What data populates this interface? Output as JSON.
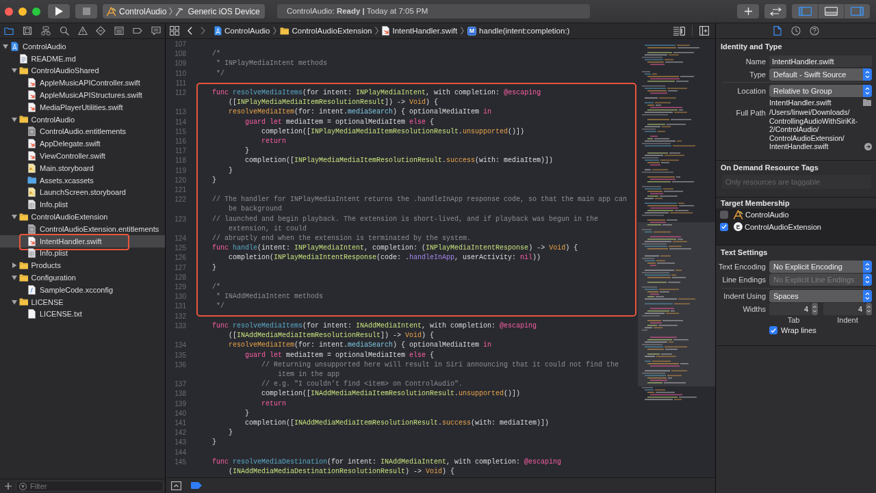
{
  "toolbar": {
    "scheme": {
      "target": "ControlAudio",
      "destination": "Generic iOS Device"
    },
    "status": "ControlAudio: **Ready |** Today at 7:05 PM",
    "panel_toggles": [
      {
        "kind": "navigator",
        "selected": true
      },
      {
        "kind": "debug_area",
        "selected": false
      },
      {
        "kind": "inspector",
        "selected": true
      }
    ]
  },
  "navigator": {
    "tabs": [
      {
        "kind": "project",
        "selected": true
      },
      {
        "kind": "source_control",
        "selected": false
      },
      {
        "kind": "symbol",
        "selected": false
      },
      {
        "kind": "find",
        "selected": false
      },
      {
        "kind": "issue",
        "selected": false
      },
      {
        "kind": "test",
        "selected": false
      },
      {
        "kind": "debug",
        "selected": false
      },
      {
        "kind": "breakpoint",
        "selected": false
      },
      {
        "kind": "report",
        "selected": false
      }
    ],
    "tree": [
      {
        "label": "ControlAudio",
        "kind": "project",
        "expanded": true,
        "selected": false,
        "annotated": false,
        "children": [
          {
            "label": "README.md",
            "kind": "markdown",
            "selected": false,
            "annotated": false
          },
          {
            "label": "ControlAudioShared",
            "kind": "folder",
            "expanded": true,
            "selected": false,
            "annotated": false,
            "children": [
              {
                "label": "AppleMusicAPIController.swift",
                "kind": "swift",
                "selected": false,
                "annotated": false
              },
              {
                "label": "AppleMusicAPIStructures.swift",
                "kind": "swift",
                "selected": false,
                "annotated": false
              },
              {
                "label": "MediaPlayerUtilities.swift",
                "kind": "swift",
                "selected": false,
                "annotated": false
              }
            ]
          },
          {
            "label": "ControlAudio",
            "kind": "folder",
            "expanded": true,
            "selected": false,
            "annotated": false,
            "children": [
              {
                "label": "ControlAudio.entitlements",
                "kind": "entitlements",
                "selected": false,
                "annotated": false
              },
              {
                "label": "AppDelegate.swift",
                "kind": "swift",
                "selected": false,
                "annotated": false
              },
              {
                "label": "ViewController.swift",
                "kind": "swift",
                "selected": false,
                "annotated": false
              },
              {
                "label": "Main.storyboard",
                "kind": "storyboard",
                "selected": false,
                "annotated": false
              },
              {
                "label": "Assets.xcassets",
                "kind": "assets",
                "selected": false,
                "annotated": false
              },
              {
                "label": "LaunchScreen.storyboard",
                "kind": "storyboard",
                "selected": false,
                "annotated": false
              },
              {
                "label": "Info.plist",
                "kind": "plist",
                "selected": false,
                "annotated": false
              }
            ]
          },
          {
            "label": "ControlAudioExtension",
            "kind": "folder",
            "expanded": true,
            "selected": false,
            "annotated": false,
            "children": [
              {
                "label": "ControlAudioExtension.entitlements",
                "kind": "entitlements",
                "selected": false,
                "annotated": false
              },
              {
                "label": "IntentHandler.swift",
                "kind": "swift",
                "selected": true,
                "annotated": true
              },
              {
                "label": "Info.plist",
                "kind": "plist",
                "selected": false,
                "annotated": false
              }
            ]
          },
          {
            "label": "Products",
            "kind": "folder",
            "expanded": false,
            "selected": false,
            "annotated": false
          },
          {
            "label": "Configuration",
            "kind": "folder",
            "expanded": true,
            "selected": false,
            "annotated": false,
            "children": [
              {
                "label": "SampleCode.xcconfig",
                "kind": "xcconfig",
                "selected": false,
                "annotated": false
              }
            ]
          },
          {
            "label": "LICENSE",
            "kind": "folder",
            "expanded": true,
            "selected": false,
            "annotated": false,
            "children": [
              {
                "label": "LICENSE.txt",
                "kind": "text",
                "selected": false,
                "annotated": false
              }
            ]
          }
        ]
      }
    ],
    "filter": {
      "placeholder": "Filter"
    }
  },
  "editor": {
    "jump_bar": [
      {
        "kind": "project",
        "label": "ControlAudio"
      },
      {
        "kind": "folder",
        "label": "ControlAudioExtension"
      },
      {
        "kind": "swift",
        "label": "IntentHandler.swift"
      },
      {
        "kind": "method",
        "badge": "M",
        "label": "handle(intent:completion:)"
      }
    ],
    "sections": [
      {
        "annotated": false,
        "lines": [
          {
            "number": "107"
          },
          {
            "number": "108",
            "tokens": [
              {
                "kind": "comment",
                "text": "    /*"
              }
            ]
          },
          {
            "number": "109",
            "tokens": [
              {
                "kind": "comment",
                "text": "     * INPlayMediaIntent methods"
              }
            ]
          },
          {
            "number": "110",
            "tokens": [
              {
                "kind": "comment",
                "text": "     */"
              }
            ]
          },
          {
            "number": "111"
          }
        ]
      },
      {
        "annotated": true,
        "lines": [
          {
            "number": "112",
            "tokens": [
              {
                "kind": "keyword",
                "text": "    func "
              },
              {
                "kind": "declaration",
                "text": "resolveMediaItems"
              },
              {
                "kind": "plain",
                "text": "(for intent: "
              },
              {
                "kind": "type",
                "text": "INPlayMediaIntent"
              },
              {
                "kind": "plain",
                "text": ", with completion: "
              },
              {
                "kind": "keyword",
                "text": "@escaping"
              },
              {
                "kind": "plain",
                "text": " (["
              },
              {
                "kind": "type",
                "text": "INPlayMediaMediaItemResolutionResult"
              },
              {
                "kind": "plain",
                "text": "]) -> "
              },
              {
                "kind": "system_type",
                "text": "Void"
              },
              {
                "kind": "plain",
                "text": ") {"
              }
            ]
          },
          {
            "number": "113",
            "tokens": [
              {
                "kind": "function",
                "text": "        resolveMediaItem"
              },
              {
                "kind": "plain",
                "text": "(for: intent."
              },
              {
                "kind": "property",
                "text": "mediaSearch"
              },
              {
                "kind": "plain",
                "text": ") { optionalMediaItem "
              },
              {
                "kind": "keyword",
                "text": "in"
              }
            ]
          },
          {
            "number": "114",
            "tokens": [
              {
                "kind": "keyword",
                "text": "            guard let"
              },
              {
                "kind": "plain",
                "text": " mediaItem = optionalMediaItem "
              },
              {
                "kind": "keyword",
                "text": "else"
              },
              {
                "kind": "plain",
                "text": " {"
              }
            ]
          },
          {
            "number": "115",
            "tokens": [
              {
                "kind": "plain",
                "text": "                completion(["
              },
              {
                "kind": "type",
                "text": "INPlayMediaMediaItemResolutionResult"
              },
              {
                "kind": "plain",
                "text": "."
              },
              {
                "kind": "function",
                "text": "unsupported"
              },
              {
                "kind": "plain",
                "text": "()])"
              }
            ]
          },
          {
            "number": "116",
            "tokens": [
              {
                "kind": "keyword",
                "text": "                return"
              }
            ]
          },
          {
            "number": "117",
            "tokens": [
              {
                "kind": "plain",
                "text": "            }"
              }
            ]
          },
          {
            "number": "118",
            "tokens": [
              {
                "kind": "plain",
                "text": "            completion(["
              },
              {
                "kind": "type",
                "text": "INPlayMediaMediaItemResolutionResult"
              },
              {
                "kind": "plain",
                "text": "."
              },
              {
                "kind": "function",
                "text": "success"
              },
              {
                "kind": "plain",
                "text": "(with: mediaItem)])"
              }
            ]
          },
          {
            "number": "119",
            "tokens": [
              {
                "kind": "plain",
                "text": "        }"
              }
            ]
          },
          {
            "number": "120",
            "tokens": [
              {
                "kind": "plain",
                "text": "    }"
              }
            ]
          },
          {
            "number": "121"
          },
          {
            "number": "122",
            "tokens": [
              {
                "kind": "comment",
                "text": "    // The handler for INPlayMediaIntent returns the .handleInApp response code, so that the main app can be background"
              }
            ]
          },
          {
            "number": "123",
            "tokens": [
              {
                "kind": "comment",
                "text": "    // launched and begin playback. The extension is short-lived, and if playback was begun in the extension, it could"
              }
            ]
          },
          {
            "number": "124",
            "tokens": [
              {
                "kind": "comment",
                "text": "    // abruptly end when the extension is terminated by the system."
              }
            ]
          },
          {
            "number": "125",
            "tokens": [
              {
                "kind": "keyword",
                "text": "    func "
              },
              {
                "kind": "declaration",
                "text": "handle"
              },
              {
                "kind": "plain",
                "text": "(intent: "
              },
              {
                "kind": "type",
                "text": "INPlayMediaIntent"
              },
              {
                "kind": "plain",
                "text": ", completion: ("
              },
              {
                "kind": "type",
                "text": "INPlayMediaIntentResponse"
              },
              {
                "kind": "plain",
                "text": ") -> "
              },
              {
                "kind": "system_type",
                "text": "Void"
              },
              {
                "kind": "plain",
                "text": ") {"
              }
            ]
          },
          {
            "number": "126",
            "tokens": [
              {
                "kind": "plain",
                "text": "        completion("
              },
              {
                "kind": "type",
                "text": "INPlayMediaIntentResponse"
              },
              {
                "kind": "plain",
                "text": "(code: ."
              },
              {
                "kind": "enum_case",
                "text": "handleInApp"
              },
              {
                "kind": "plain",
                "text": ", userActivity: "
              },
              {
                "kind": "keyword",
                "text": "nil"
              },
              {
                "kind": "plain",
                "text": "))"
              }
            ]
          },
          {
            "number": "127",
            "tokens": [
              {
                "kind": "plain",
                "text": "    }"
              }
            ]
          },
          {
            "number": "128"
          },
          {
            "number": "129",
            "tokens": [
              {
                "kind": "comment",
                "text": "    /*"
              }
            ]
          },
          {
            "number": "130",
            "tokens": [
              {
                "kind": "comment",
                "text": "     * INAddMediaIntent methods"
              }
            ]
          },
          {
            "number": "131",
            "tokens": [
              {
                "kind": "comment",
                "text": "     */"
              }
            ]
          }
        ]
      },
      {
        "annotated": false,
        "lines": [
          {
            "number": "132"
          },
          {
            "number": "133",
            "tokens": [
              {
                "kind": "keyword",
                "text": "    func "
              },
              {
                "kind": "declaration",
                "text": "resolveMediaItems"
              },
              {
                "kind": "plain",
                "text": "(for intent: "
              },
              {
                "kind": "type",
                "text": "INAddMediaIntent"
              },
              {
                "kind": "plain",
                "text": ", with completion: "
              },
              {
                "kind": "keyword",
                "text": "@escaping"
              },
              {
                "kind": "plain",
                "text": " (["
              },
              {
                "kind": "type",
                "text": "INAddMediaMediaItemResolutionResult"
              },
              {
                "kind": "plain",
                "text": "]) -> "
              },
              {
                "kind": "system_type",
                "text": "Void"
              },
              {
                "kind": "plain",
                "text": ") {"
              }
            ]
          },
          {
            "number": "134",
            "tokens": [
              {
                "kind": "function",
                "text": "        resolveMediaItem"
              },
              {
                "kind": "plain",
                "text": "(for: intent."
              },
              {
                "kind": "property",
                "text": "mediaSearch"
              },
              {
                "kind": "plain",
                "text": ") { optionalMediaItem "
              },
              {
                "kind": "keyword",
                "text": "in"
              }
            ]
          },
          {
            "number": "135",
            "tokens": [
              {
                "kind": "keyword",
                "text": "            guard let"
              },
              {
                "kind": "plain",
                "text": " mediaItem = optionalMediaItem "
              },
              {
                "kind": "keyword",
                "text": "else"
              },
              {
                "kind": "plain",
                "text": " {"
              }
            ]
          },
          {
            "number": "136",
            "tokens": [
              {
                "kind": "comment",
                "text": "                // Returning unsupported here will result in Siri announcing that it could not find the item in the app"
              }
            ]
          },
          {
            "number": "137",
            "tokens": [
              {
                "kind": "comment",
                "text": "                // e.g. \"I couldn't find <item> on ControlAudio\"."
              }
            ]
          },
          {
            "number": "138",
            "tokens": [
              {
                "kind": "plain",
                "text": "                completion(["
              },
              {
                "kind": "type",
                "text": "INAddMediaMediaItemResolutionResult"
              },
              {
                "kind": "plain",
                "text": "."
              },
              {
                "kind": "function",
                "text": "unsupported"
              },
              {
                "kind": "plain",
                "text": "()])"
              }
            ]
          },
          {
            "number": "139",
            "tokens": [
              {
                "kind": "keyword",
                "text": "                return"
              }
            ]
          },
          {
            "number": "140",
            "tokens": [
              {
                "kind": "plain",
                "text": "            }"
              }
            ]
          },
          {
            "number": "141",
            "tokens": [
              {
                "kind": "plain",
                "text": "            completion(["
              },
              {
                "kind": "type",
                "text": "INAddMediaMediaItemResolutionResult"
              },
              {
                "kind": "plain",
                "text": "."
              },
              {
                "kind": "function",
                "text": "success"
              },
              {
                "kind": "plain",
                "text": "(with: mediaItem)])"
              }
            ]
          },
          {
            "number": "142",
            "tokens": [
              {
                "kind": "plain",
                "text": "        }"
              }
            ]
          },
          {
            "number": "143",
            "tokens": [
              {
                "kind": "plain",
                "text": "    }"
              }
            ]
          },
          {
            "number": "144"
          },
          {
            "number": "145",
            "tokens": [
              {
                "kind": "keyword",
                "text": "    func "
              },
              {
                "kind": "declaration",
                "text": "resolveMediaDestination"
              },
              {
                "kind": "plain",
                "text": "(for intent: "
              },
              {
                "kind": "type",
                "text": "INAddMediaIntent"
              },
              {
                "kind": "plain",
                "text": ", with completion: "
              },
              {
                "kind": "keyword",
                "text": "@escaping"
              },
              {
                "kind": "plain",
                "text": " ("
              },
              {
                "kind": "type",
                "text": "INAddMediaMediaDestinationResolutionResult"
              },
              {
                "kind": "plain",
                "text": ") -> "
              },
              {
                "kind": "system_type",
                "text": "Void"
              },
              {
                "kind": "plain",
                "text": ") {"
              }
            ]
          }
        ]
      }
    ],
    "breakpoints_active": true
  },
  "inspector": {
    "tabs": [
      {
        "kind": "file",
        "selected": true
      },
      {
        "kind": "history",
        "selected": false
      },
      {
        "kind": "help",
        "selected": false
      }
    ],
    "sections": [
      {
        "kind": "form",
        "title": "Identity and Type",
        "rows": [
          {
            "kind": "text_field",
            "label": "Name",
            "value": "IntentHandler.swift"
          },
          {
            "kind": "popup",
            "label": "Type",
            "value": "Default - Swift Source",
            "disabled": false
          },
          {
            "kind": "separator"
          },
          {
            "kind": "popup",
            "label": "Location",
            "value": "Relative to Group",
            "disabled": false
          },
          {
            "kind": "file_name",
            "value": "IntentHandler.swift"
          },
          {
            "kind": "path",
            "label": "Full Path",
            "value": "/Users/linwei/Downloads/ControllingAudioWithSiriKit-2/ControlAudio/ControlAudioExtension/IntentHandler.swift"
          }
        ]
      },
      {
        "kind": "tags",
        "title": "On Demand Resource Tags",
        "placeholder": "Only resources are taggable"
      },
      {
        "kind": "targets",
        "title": "Target Membership",
        "targets": [
          {
            "kind": "app",
            "label": "ControlAudio",
            "checked": false
          },
          {
            "kind": "extension",
            "badge": "E",
            "label": "ControlAudioExtension",
            "checked": true
          }
        ]
      },
      {
        "kind": "form",
        "title": "Text Settings",
        "rows": [
          {
            "kind": "popup",
            "label": "Text Encoding",
            "value": "No Explicit Encoding",
            "disabled": false
          },
          {
            "kind": "popup",
            "label": "Line Endings",
            "value": "No Explicit Line Endings",
            "disabled": true
          },
          {
            "kind": "separator"
          },
          {
            "kind": "popup",
            "label": "Indent Using",
            "value": "Spaces",
            "disabled": false
          },
          {
            "kind": "steppers",
            "label": "Widths",
            "fields": [
              {
                "value": "4",
                "caption": "Tab"
              },
              {
                "value": "4",
                "caption": "Indent"
              }
            ]
          },
          {
            "kind": "checkbox",
            "label": "Wrap lines",
            "checked": true
          }
        ]
      }
    ]
  }
}
